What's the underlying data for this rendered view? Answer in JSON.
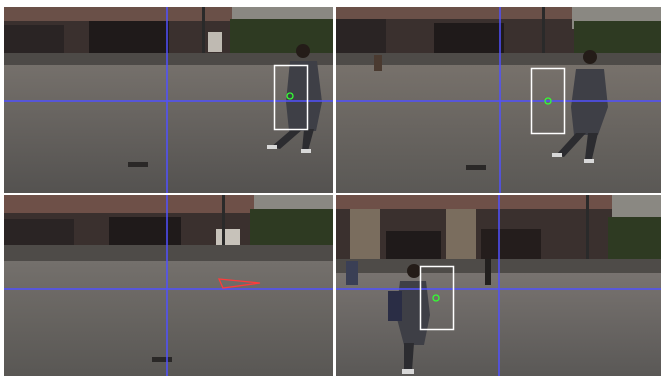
{
  "figure": {
    "panels": [
      {
        "id": "top-left",
        "overlay": "tracking-box",
        "marker": "center-circle"
      },
      {
        "id": "top-right",
        "overlay": "tracking-box",
        "marker": "center-circle"
      },
      {
        "id": "bottom-left",
        "overlay": "direction-triangle",
        "marker": "none"
      },
      {
        "id": "bottom-right",
        "overlay": "tracking-box",
        "marker": "center-circle"
      }
    ],
    "colors": {
      "crosshair": "#5050ff",
      "tracking_box": "#ffffff",
      "center_marker": "#33ff33",
      "direction_marker": "#ff3b3b",
      "background": "#ffffff"
    }
  }
}
